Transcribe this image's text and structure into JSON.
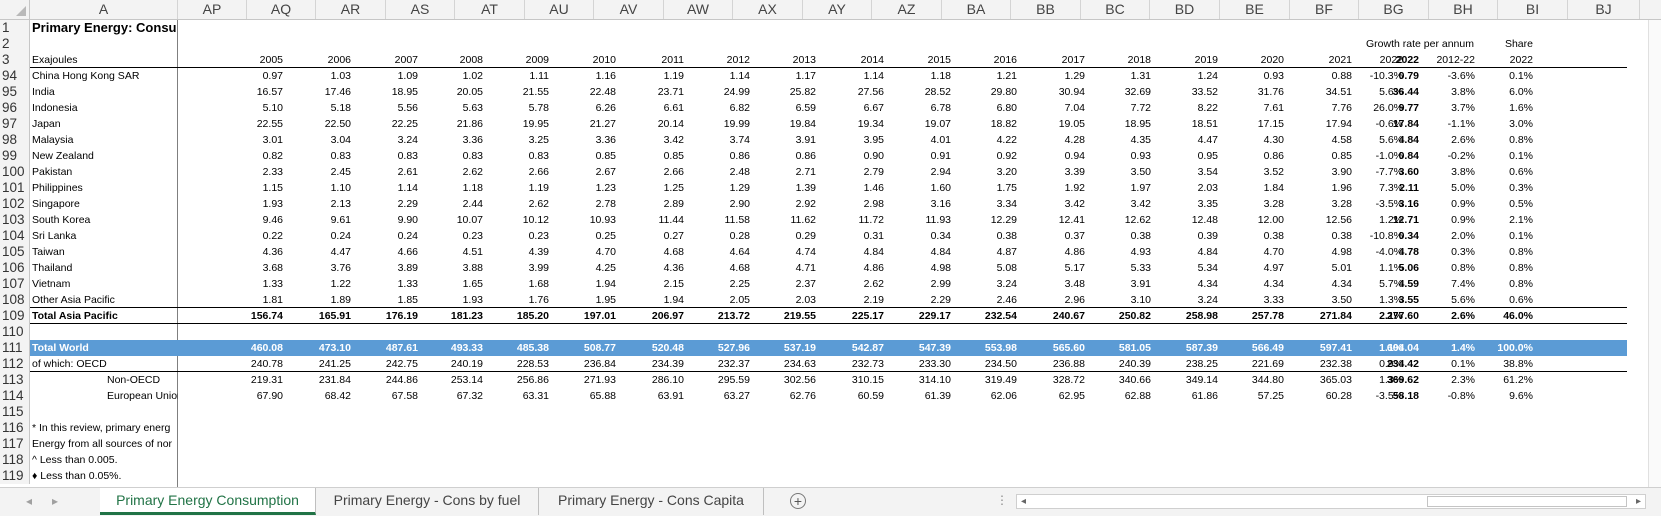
{
  "columns": [
    {
      "letter": "A"
    },
    {
      "letter": "AP"
    },
    {
      "letter": "AQ"
    },
    {
      "letter": "AR"
    },
    {
      "letter": "AS"
    },
    {
      "letter": "AT"
    },
    {
      "letter": "AU"
    },
    {
      "letter": "AV"
    },
    {
      "letter": "AW"
    },
    {
      "letter": "AX"
    },
    {
      "letter": "AY"
    },
    {
      "letter": "AZ"
    },
    {
      "letter": "BA"
    },
    {
      "letter": "BB"
    },
    {
      "letter": "BC"
    },
    {
      "letter": "BD"
    },
    {
      "letter": "BE"
    },
    {
      "letter": "BF"
    },
    {
      "letter": "BG"
    },
    {
      "letter": "BH"
    },
    {
      "letter": "BI"
    },
    {
      "letter": "BJ"
    }
  ],
  "rows": [
    {
      "num": "1",
      "cells": [
        "Primary Energy: Consu"
      ],
      "style": "title"
    },
    {
      "num": "2",
      "cells": [
        "",
        "",
        "",
        "",
        "",
        "",
        "",
        "",
        "",
        "",
        "",
        "",
        "",
        "",
        "",
        "",
        "",
        "",
        "",
        "Growth rate per annum",
        "",
        "Share"
      ],
      "style": "hdr2"
    },
    {
      "num": "3",
      "cells": [
        "Exajoules",
        "2005",
        "2006",
        "2007",
        "2008",
        "2009",
        "2010",
        "2011",
        "2012",
        "2013",
        "2014",
        "2015",
        "2016",
        "2017",
        "2018",
        "2019",
        "2020",
        "2021",
        "2022",
        "2022",
        "2012-22",
        "2022"
      ],
      "style": "hdr3"
    },
    {
      "num": "94",
      "cells": [
        "China Hong Kong SAR",
        "0.97",
        "1.03",
        "1.09",
        "1.02",
        "1.11",
        "1.16",
        "1.19",
        "1.14",
        "1.17",
        "1.14",
        "1.18",
        "1.21",
        "1.29",
        "1.31",
        "1.24",
        "0.93",
        "0.88",
        "0.79",
        "-10.3%",
        "-3.6%",
        "0.1%"
      ]
    },
    {
      "num": "95",
      "cells": [
        "India",
        "16.57",
        "17.46",
        "18.95",
        "20.05",
        "21.55",
        "22.48",
        "23.71",
        "24.99",
        "25.82",
        "27.56",
        "28.52",
        "29.80",
        "30.94",
        "32.69",
        "33.52",
        "31.76",
        "34.51",
        "36.44",
        "5.6%",
        "3.8%",
        "6.0%"
      ]
    },
    {
      "num": "96",
      "cells": [
        "Indonesia",
        "5.10",
        "5.18",
        "5.56",
        "5.63",
        "5.78",
        "6.26",
        "6.61",
        "6.82",
        "6.59",
        "6.67",
        "6.78",
        "6.80",
        "7.04",
        "7.72",
        "8.22",
        "7.61",
        "7.76",
        "9.77",
        "26.0%",
        "3.7%",
        "1.6%"
      ]
    },
    {
      "num": "97",
      "cells": [
        "Japan",
        "22.55",
        "22.50",
        "22.25",
        "21.86",
        "19.95",
        "21.27",
        "20.14",
        "19.99",
        "19.84",
        "19.34",
        "19.07",
        "18.82",
        "19.05",
        "18.95",
        "18.51",
        "17.15",
        "17.94",
        "17.84",
        "-0.6%",
        "-1.1%",
        "3.0%"
      ]
    },
    {
      "num": "98",
      "cells": [
        "Malaysia",
        "3.01",
        "3.04",
        "3.24",
        "3.36",
        "3.25",
        "3.36",
        "3.42",
        "3.74",
        "3.91",
        "3.95",
        "4.01",
        "4.22",
        "4.28",
        "4.35",
        "4.47",
        "4.30",
        "4.58",
        "4.84",
        "5.6%",
        "2.6%",
        "0.8%"
      ]
    },
    {
      "num": "99",
      "cells": [
        "New Zealand",
        "0.82",
        "0.83",
        "0.83",
        "0.83",
        "0.83",
        "0.85",
        "0.85",
        "0.86",
        "0.86",
        "0.90",
        "0.91",
        "0.92",
        "0.94",
        "0.93",
        "0.95",
        "0.86",
        "0.85",
        "0.84",
        "-1.0%",
        "-0.2%",
        "0.1%"
      ]
    },
    {
      "num": "100",
      "cells": [
        "Pakistan",
        "2.33",
        "2.45",
        "2.61",
        "2.62",
        "2.66",
        "2.67",
        "2.66",
        "2.48",
        "2.71",
        "2.79",
        "2.94",
        "3.20",
        "3.39",
        "3.50",
        "3.54",
        "3.52",
        "3.90",
        "3.60",
        "-7.7%",
        "3.8%",
        "0.6%"
      ]
    },
    {
      "num": "101",
      "cells": [
        "Philippines",
        "1.15",
        "1.10",
        "1.14",
        "1.18",
        "1.19",
        "1.23",
        "1.25",
        "1.29",
        "1.39",
        "1.46",
        "1.60",
        "1.75",
        "1.92",
        "1.97",
        "2.03",
        "1.84",
        "1.96",
        "2.11",
        "7.3%",
        "5.0%",
        "0.3%"
      ]
    },
    {
      "num": "102",
      "cells": [
        "Singapore",
        "1.93",
        "2.13",
        "2.29",
        "2.44",
        "2.62",
        "2.78",
        "2.89",
        "2.90",
        "2.92",
        "2.98",
        "3.16",
        "3.34",
        "3.42",
        "3.42",
        "3.35",
        "3.28",
        "3.28",
        "3.16",
        "-3.5%",
        "0.9%",
        "0.5%"
      ]
    },
    {
      "num": "103",
      "cells": [
        "South Korea",
        "9.46",
        "9.61",
        "9.90",
        "10.07",
        "10.12",
        "10.93",
        "11.44",
        "11.58",
        "11.62",
        "11.72",
        "11.93",
        "12.29",
        "12.41",
        "12.62",
        "12.48",
        "12.00",
        "12.56",
        "12.71",
        "1.2%",
        "0.9%",
        "2.1%"
      ]
    },
    {
      "num": "104",
      "cells": [
        "Sri Lanka",
        "0.22",
        "0.24",
        "0.24",
        "0.23",
        "0.23",
        "0.25",
        "0.27",
        "0.28",
        "0.29",
        "0.31",
        "0.34",
        "0.38",
        "0.37",
        "0.38",
        "0.39",
        "0.38",
        "0.38",
        "0.34",
        "-10.8%",
        "2.0%",
        "0.1%"
      ]
    },
    {
      "num": "105",
      "cells": [
        "Taiwan",
        "4.36",
        "4.47",
        "4.66",
        "4.51",
        "4.39",
        "4.70",
        "4.68",
        "4.64",
        "4.74",
        "4.84",
        "4.84",
        "4.87",
        "4.86",
        "4.93",
        "4.84",
        "4.70",
        "4.98",
        "4.78",
        "-4.0%",
        "0.3%",
        "0.8%"
      ]
    },
    {
      "num": "106",
      "cells": [
        "Thailand",
        "3.68",
        "3.76",
        "3.89",
        "3.88",
        "3.99",
        "4.25",
        "4.36",
        "4.68",
        "4.71",
        "4.86",
        "4.98",
        "5.08",
        "5.17",
        "5.33",
        "5.34",
        "4.97",
        "5.01",
        "5.06",
        "1.1%",
        "0.8%",
        "0.8%"
      ]
    },
    {
      "num": "107",
      "cells": [
        "Vietnam",
        "1.33",
        "1.22",
        "1.33",
        "1.65",
        "1.68",
        "1.94",
        "2.15",
        "2.25",
        "2.37",
        "2.62",
        "2.99",
        "3.24",
        "3.48",
        "3.91",
        "4.34",
        "4.34",
        "4.34",
        "4.59",
        "5.7%",
        "7.4%",
        "0.8%"
      ]
    },
    {
      "num": "108",
      "cells": [
        "Other Asia Pacific",
        "1.81",
        "1.89",
        "1.85",
        "1.93",
        "1.76",
        "1.95",
        "1.94",
        "2.05",
        "2.03",
        "2.19",
        "2.29",
        "2.46",
        "2.96",
        "3.10",
        "3.24",
        "3.33",
        "3.50",
        "3.55",
        "1.3%",
        "5.6%",
        "0.6%"
      ]
    },
    {
      "num": "109",
      "cells": [
        "Total Asia Pacific",
        "156.74",
        "165.91",
        "176.19",
        "181.23",
        "185.20",
        "197.01",
        "206.97",
        "213.72",
        "219.55",
        "225.17",
        "229.17",
        "232.54",
        "240.67",
        "250.82",
        "258.98",
        "257.78",
        "271.84",
        "277.60",
        "2.1%",
        "2.6%",
        "46.0%"
      ],
      "style": "total"
    },
    {
      "num": "110",
      "cells": []
    },
    {
      "num": "111",
      "cells": [
        "Total World",
        "460.08",
        "473.10",
        "487.61",
        "493.33",
        "485.38",
        "508.77",
        "520.48",
        "527.96",
        "537.19",
        "542.87",
        "547.39",
        "553.98",
        "565.60",
        "581.05",
        "587.39",
        "566.49",
        "597.41",
        "604.04",
        "1.1%",
        "1.4%",
        "100.0%"
      ],
      "style": "world"
    },
    {
      "num": "112",
      "cells": [
        "of which: OECD",
        "240.78",
        "241.25",
        "242.75",
        "240.19",
        "228.53",
        "236.84",
        "234.39",
        "232.37",
        "234.63",
        "232.73",
        "233.30",
        "234.50",
        "236.88",
        "240.39",
        "238.25",
        "221.69",
        "232.38",
        "234.42",
        "0.9%",
        "0.1%",
        "38.8%"
      ]
    },
    {
      "num": "113",
      "cells": [
        "Non-OECD",
        "219.31",
        "231.84",
        "244.86",
        "253.14",
        "256.86",
        "271.93",
        "286.10",
        "295.59",
        "302.56",
        "310.15",
        "314.10",
        "319.49",
        "328.72",
        "340.66",
        "349.14",
        "344.80",
        "365.03",
        "369.62",
        "1.3%",
        "2.3%",
        "61.2%"
      ],
      "style": "indent"
    },
    {
      "num": "114",
      "cells": [
        "European Union#",
        "67.90",
        "68.42",
        "67.58",
        "67.32",
        "63.31",
        "65.88",
        "63.91",
        "63.27",
        "62.76",
        "60.59",
        "61.39",
        "62.06",
        "62.95",
        "62.88",
        "61.86",
        "57.25",
        "60.28",
        "58.18",
        "-3.5%",
        "-0.8%",
        "9.6%"
      ],
      "style": "indent"
    },
    {
      "num": "115",
      "cells": []
    },
    {
      "num": "116",
      "cells": [
        "* In this review, primary energ"
      ],
      "style": "note"
    },
    {
      "num": "117",
      "cells": [
        "Energy from all sources of nor"
      ],
      "style": "note"
    },
    {
      "num": "118",
      "cells": [
        "^ Less than 0.005."
      ],
      "style": "note"
    },
    {
      "num": "119",
      "cells": [
        "♦ Less than 0.05%."
      ],
      "style": "note"
    }
  ],
  "tabs": [
    {
      "label": "Primary Energy Consumption",
      "active": true
    },
    {
      "label": "Primary Energy - Cons by fuel",
      "active": false
    },
    {
      "label": "Primary Energy - Cons Capita",
      "active": false
    }
  ],
  "ui": {
    "add_sheet": "+",
    "more": "⋮",
    "nav_prev": "◂",
    "nav_next": "▸",
    "scroll_left": "◂",
    "scroll_right": "▸"
  },
  "colors": {
    "highlight_row": "#5b9bd5",
    "active_tab": "#217346"
  }
}
